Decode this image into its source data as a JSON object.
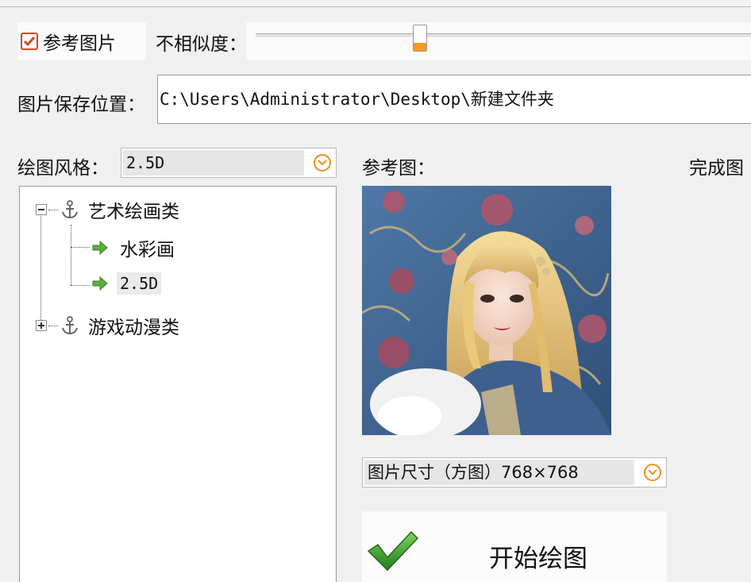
{
  "reference": {
    "checkbox_label": "参考图片",
    "checked": true,
    "similarity_label": "不相似度：",
    "similarity_value": 0.34
  },
  "save": {
    "label": "图片保存位置：",
    "path": "C:\\Users\\Administrator\\Desktop\\新建文件夹"
  },
  "style": {
    "label": "绘图风格：",
    "selected": "2.5D"
  },
  "tree": {
    "group1": "艺术绘画类",
    "child1": "水彩画",
    "child2": "2.5D",
    "group2": "游戏动漫类"
  },
  "preview": {
    "ref_title": "参考图：",
    "done_title": "完成图"
  },
  "size": {
    "selected": "图片尺寸（方图）768×768"
  },
  "start": {
    "label": "开始绘图"
  },
  "colors": {
    "accent": "#ef8f1c",
    "checkbox": "#d04a1c",
    "tree_arrow": "#5cae3a",
    "start_check": "#2e9c2a"
  },
  "icons": {
    "dropdown": "chevron-down-circle-icon",
    "tree_group": "anchor-icon",
    "tree_leaf": "arrow-right-icon",
    "start": "checkmark-icon"
  }
}
